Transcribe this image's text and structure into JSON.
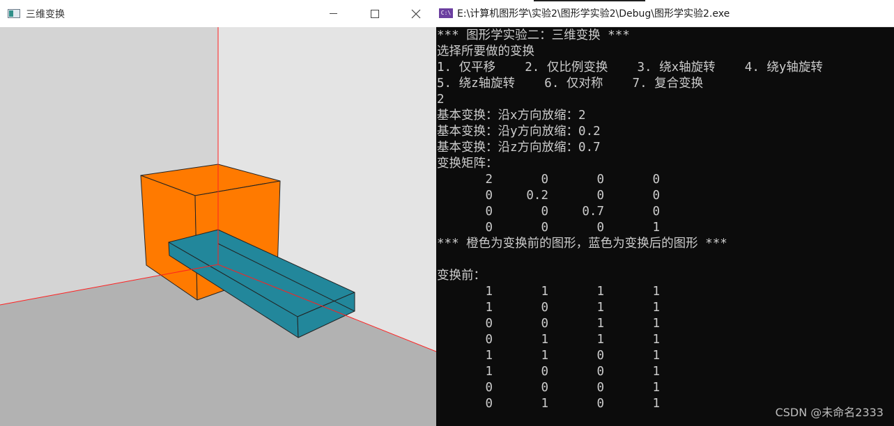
{
  "left_window": {
    "title": "三维变换",
    "icon": "app-window-icon",
    "buttons": [
      "minimize-icon",
      "maximize-icon",
      "close-icon"
    ]
  },
  "right_window": {
    "title": "E:\\计算机图形学\\实验2\\图形学实验2\\Debug\\图形学实验2.exe",
    "icon": "visual-studio-console-icon",
    "icon_text": "C:\\"
  },
  "scene": {
    "colors": {
      "wall_left": "#d4d4d4",
      "wall_right": "#e4e4e4",
      "floor": "#b2b2b2",
      "axis": "#ff2020",
      "original_shape": "#ff7a00",
      "transformed_shape": "#22879b",
      "edge": "#222222"
    }
  },
  "console": {
    "intro_lines": [
      "*** 图形学实验二：三维变换 ***",
      "选择所要做的变换",
      "1. 仅平移    2. 仅比例变换    3. 绕x轴旋转    4. 绕y轴旋转",
      "5. 绕z轴旋转    6. 仅对称    7. 复合变换",
      "2",
      "基本变换：沿x方向放缩：2",
      "基本变换：沿y方向放缩：0.2",
      "基本变换：沿z方向放缩：0.7",
      "变换矩阵："
    ],
    "matrix": [
      [
        "2",
        "0",
        "0",
        "0"
      ],
      [
        "0",
        "0.2",
        "0",
        "0"
      ],
      [
        "0",
        "0",
        "0.7",
        "0"
      ],
      [
        "0",
        "0",
        "0",
        "1"
      ]
    ],
    "legend_line": "*** 橙色为变换前的图形，蓝色为变换后的图形 ***",
    "blank_line": "",
    "before_label": "变换前：",
    "before_rows": [
      [
        "1",
        "1",
        "1",
        "1"
      ],
      [
        "1",
        "0",
        "1",
        "1"
      ],
      [
        "0",
        "0",
        "1",
        "1"
      ],
      [
        "0",
        "1",
        "1",
        "1"
      ],
      [
        "1",
        "1",
        "0",
        "1"
      ],
      [
        "1",
        "0",
        "0",
        "1"
      ],
      [
        "0",
        "0",
        "0",
        "1"
      ],
      [
        "0",
        "1",
        "0",
        "1"
      ]
    ],
    "watermark": "CSDN @未命名2333"
  }
}
